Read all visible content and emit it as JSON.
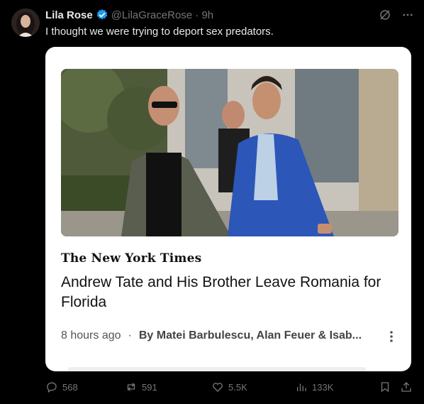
{
  "tweet": {
    "author_name": "Lila Rose",
    "handle_time": "@LilaGraceRose · 9h",
    "text": "I thought we were trying to deport sex predators."
  },
  "card": {
    "publication": "The New York Times",
    "headline": "Andrew Tate and His Brother Leave Romania for Florida",
    "time_ago": "8 hours ago",
    "separator": "·",
    "byline": "By Matei Barbulescu, Alan Feuer & Isab..."
  },
  "actions": {
    "replies": "568",
    "reposts": "591",
    "likes": "5.5K",
    "views": "133K"
  },
  "colors": {
    "background": "#000000",
    "text": "#e7e9ea",
    "muted": "#71767b",
    "verified": "#1d9bf0"
  },
  "icons": [
    "verified-badge-icon",
    "grok-icon",
    "more-icon",
    "reply-icon",
    "repost-icon",
    "like-icon",
    "views-icon",
    "bookmark-icon",
    "share-icon",
    "card-more-icon"
  ]
}
